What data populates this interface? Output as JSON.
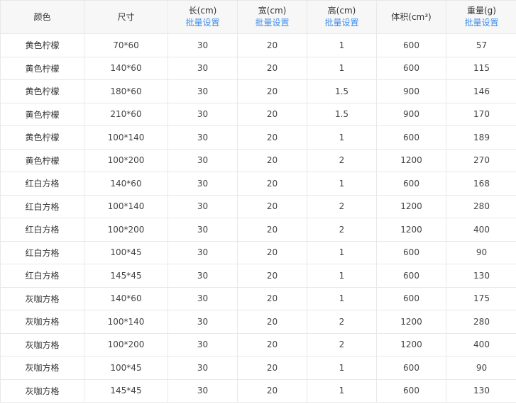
{
  "table": {
    "headers": [
      {
        "label": "颜色",
        "batch": ""
      },
      {
        "label": "尺寸",
        "batch": ""
      },
      {
        "label": "长(cm)",
        "batch": "批量设置"
      },
      {
        "label": "宽(cm)",
        "batch": "批量设置"
      },
      {
        "label": "高(cm)",
        "batch": "批量设置"
      },
      {
        "label": "体积(cm³)",
        "batch": ""
      },
      {
        "label": "重量(g)",
        "batch": "批量设置"
      }
    ],
    "rows": [
      [
        "黄色柠檬",
        "70*60",
        "30",
        "20",
        "1",
        "600",
        "57"
      ],
      [
        "黄色柠檬",
        "140*60",
        "30",
        "20",
        "1",
        "600",
        "115"
      ],
      [
        "黄色柠檬",
        "180*60",
        "30",
        "20",
        "1.5",
        "900",
        "146"
      ],
      [
        "黄色柠檬",
        "210*60",
        "30",
        "20",
        "1.5",
        "900",
        "170"
      ],
      [
        "黄色柠檬",
        "100*140",
        "30",
        "20",
        "1",
        "600",
        "189"
      ],
      [
        "黄色柠檬",
        "100*200",
        "30",
        "20",
        "2",
        "1200",
        "270"
      ],
      [
        "红白方格",
        "140*60",
        "30",
        "20",
        "1",
        "600",
        "168"
      ],
      [
        "红白方格",
        "100*140",
        "30",
        "20",
        "2",
        "1200",
        "280"
      ],
      [
        "红白方格",
        "100*200",
        "30",
        "20",
        "2",
        "1200",
        "400"
      ],
      [
        "红白方格",
        "100*45",
        "30",
        "20",
        "1",
        "600",
        "90"
      ],
      [
        "红白方格",
        "145*45",
        "30",
        "20",
        "1",
        "600",
        "130"
      ],
      [
        "灰咖方格",
        "140*60",
        "30",
        "20",
        "1",
        "600",
        "175"
      ],
      [
        "灰咖方格",
        "100*140",
        "30",
        "20",
        "2",
        "1200",
        "280"
      ],
      [
        "灰咖方格",
        "100*200",
        "30",
        "20",
        "2",
        "1200",
        "400"
      ],
      [
        "灰咖方格",
        "100*45",
        "30",
        "20",
        "1",
        "600",
        "90"
      ],
      [
        "灰咖方格",
        "145*45",
        "30",
        "20",
        "1",
        "600",
        "130"
      ]
    ]
  }
}
